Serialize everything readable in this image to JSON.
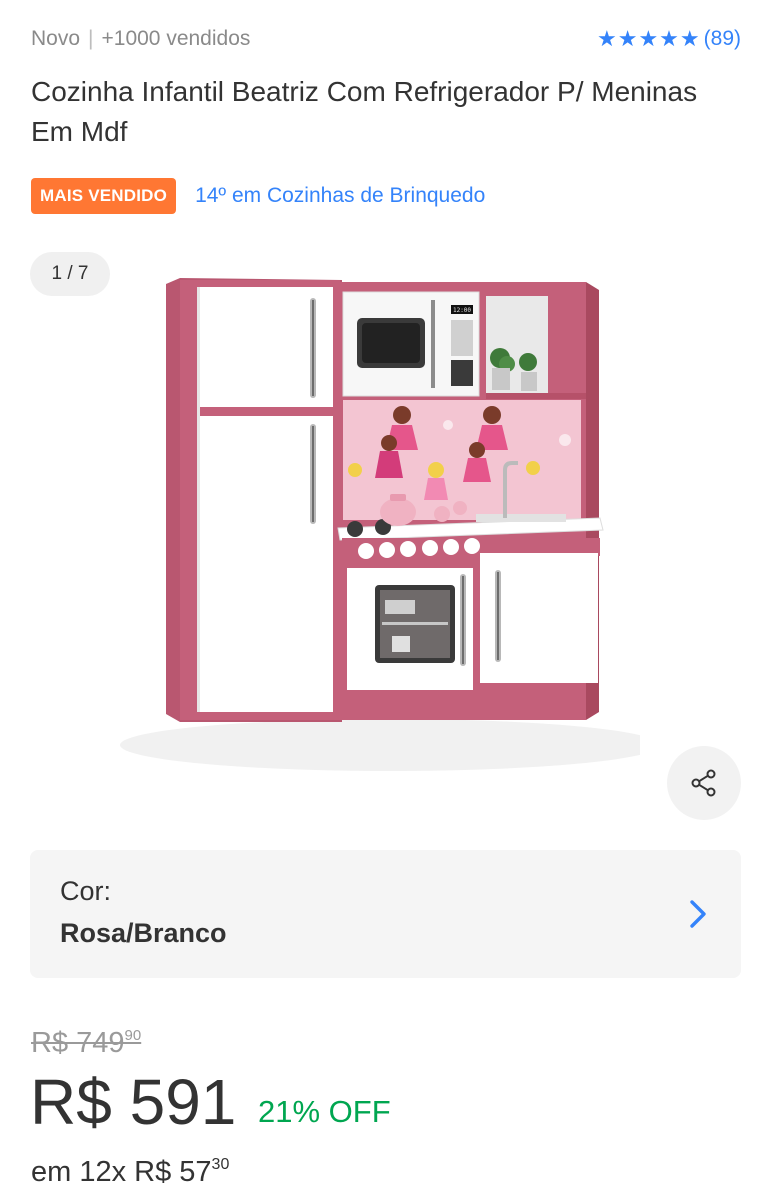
{
  "header": {
    "condition": "Novo",
    "separator": "|",
    "sold": "+1000 vendidos",
    "rating_stars": 5,
    "rating_count": "(89)"
  },
  "product": {
    "title": "Cozinha Infantil Beatriz Com Refrigerador P/ Meninas Em Mdf",
    "badge": "MAIS VENDIDO",
    "rank": "14º em Cozinhas de Brinquedo"
  },
  "gallery": {
    "counter": "1 / 7",
    "image_alt": "toy kitchen pink and white",
    "microwave_display": "12:00"
  },
  "variation": {
    "label": "Cor:",
    "value": "Rosa/Branco"
  },
  "pricing": {
    "old_price": "R$ 749",
    "old_cents": "90",
    "price": "R$ 591",
    "discount": "21% OFF",
    "installments": "em 12x R$ 57",
    "installment_cents": "30"
  },
  "colors": {
    "accent_blue": "#3483fa",
    "badge_orange": "#ff7733",
    "discount_green": "#00a650",
    "kitchen_pink": "#c4607a"
  },
  "icons": {
    "rating": "star-icon",
    "share": "share-icon",
    "variation_next": "chevron-right-icon"
  }
}
